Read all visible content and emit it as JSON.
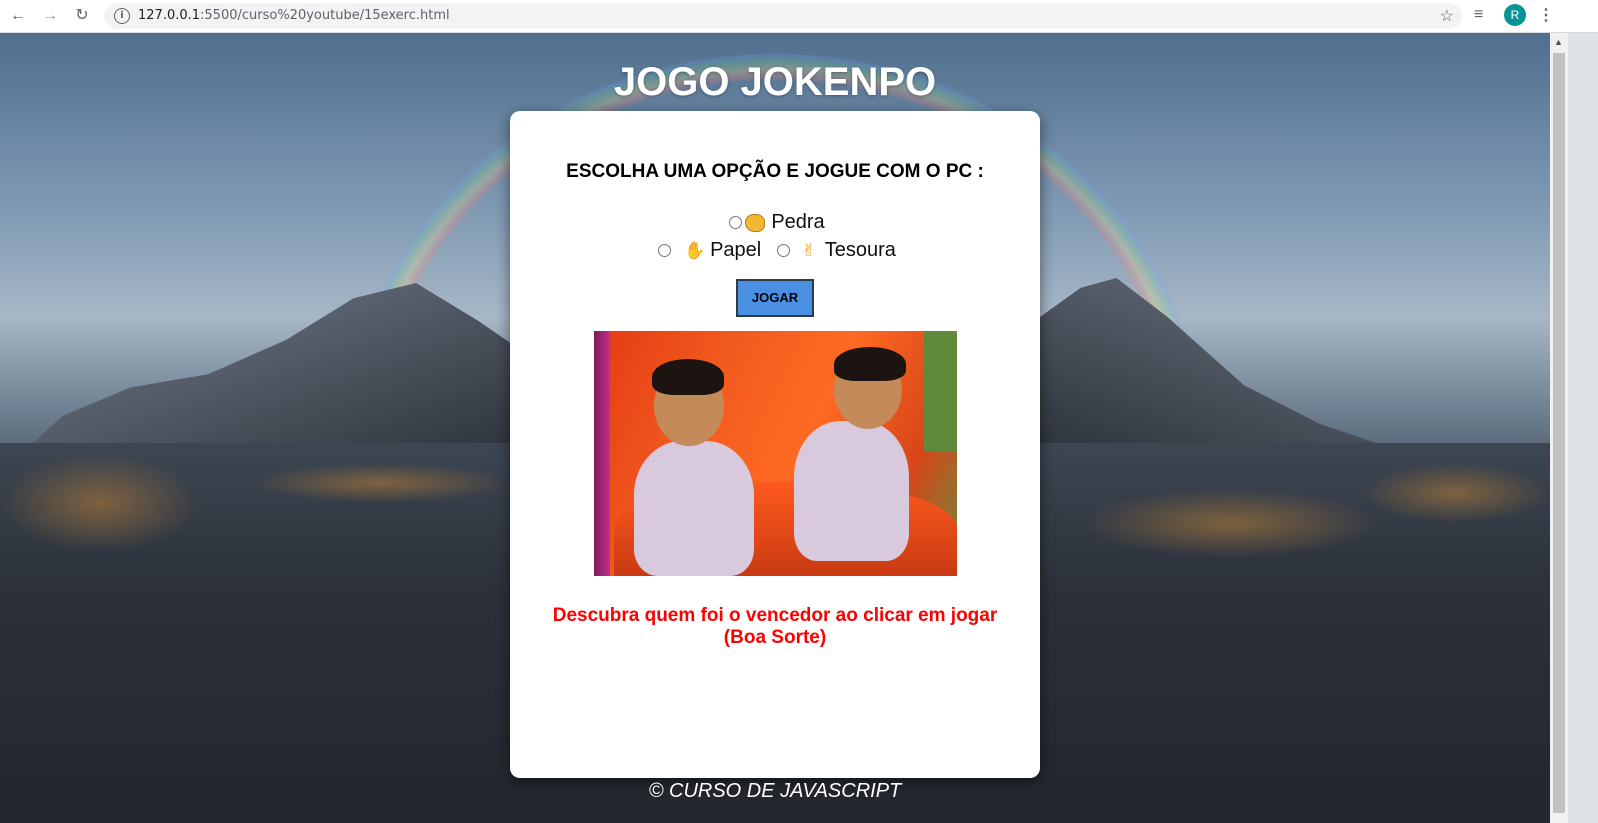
{
  "browser": {
    "url_host": "127.0.0.1",
    "url_path": ":5500/curso%20youtube/15exerc.html",
    "profile_initial": "R",
    "icons": [
      "back-icon",
      "forward-icon",
      "reload-icon",
      "info-icon",
      "star-icon",
      "media-control-icon",
      "menu-icon"
    ]
  },
  "page": {
    "title": "JOGO JOKENPO",
    "instruction": "ESCOLHA UMA OPÇÃO E JOGUE COM O PC :",
    "options": [
      {
        "label": "Pedra",
        "icon": "fist-emoji-icon"
      },
      {
        "label": "Papel",
        "icon": "raised-hand-emoji-icon"
      },
      {
        "label": "Tesoura",
        "icon": "victory-hand-emoji-icon"
      }
    ],
    "play_button": "JOGAR",
    "result_line1": "Descubra quem foi o vencedor ao clicar em jogar",
    "result_line2": "(Boa Sorte)",
    "footer": "© CURSO DE JAVASCRIPT"
  },
  "colors": {
    "button": "#4a90e2",
    "result_text": "#ff0000",
    "card": "#ffffff",
    "avatar": "#0a9396"
  }
}
